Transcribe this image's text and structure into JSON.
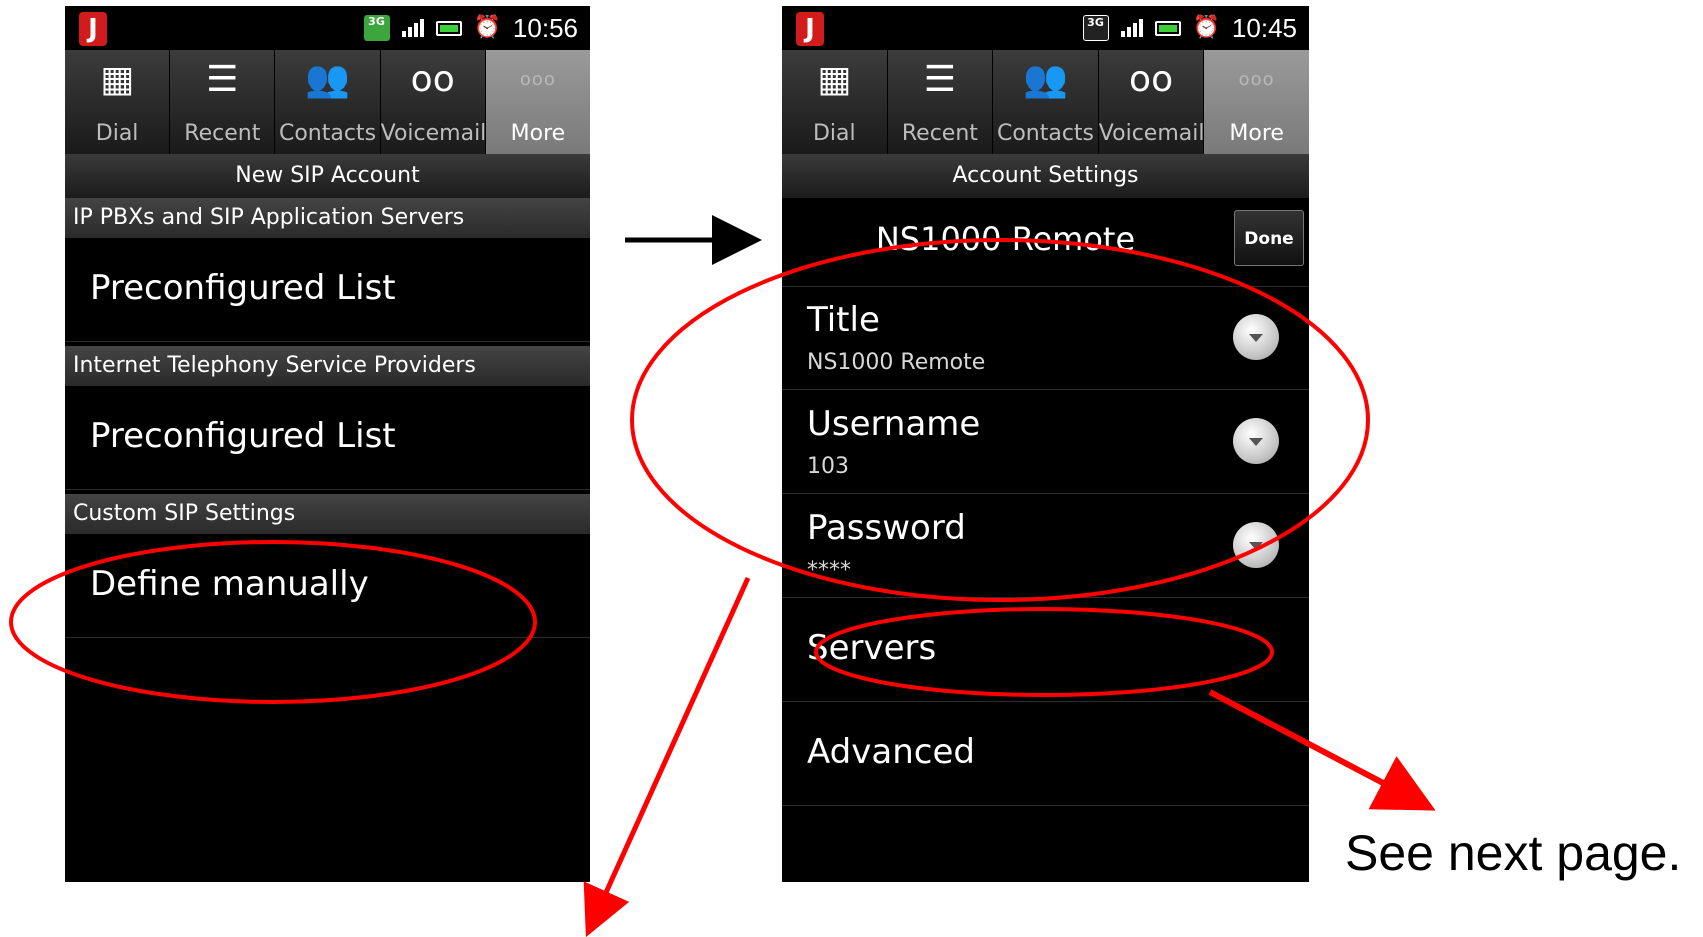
{
  "left_screen": {
    "status": {
      "network": "3G",
      "time": "10:56"
    },
    "tabs": [
      {
        "label": "Dial",
        "icon": "dialpad-icon"
      },
      {
        "label": "Recent",
        "icon": "list-icon"
      },
      {
        "label": "Contacts",
        "icon": "contacts-icon"
      },
      {
        "label": "Voicemail",
        "icon": "voicemail-icon"
      },
      {
        "label": "More",
        "icon": "more-icon",
        "active": true
      }
    ],
    "title": "New SIP Account",
    "sections": [
      {
        "header": "IP PBXs and SIP Application Servers",
        "item": "Preconfigured List"
      },
      {
        "header": "Internet Telephony Service Providers",
        "item": "Preconfigured List"
      },
      {
        "header": "Custom SIP Settings",
        "item": "Define manually"
      }
    ]
  },
  "right_screen": {
    "status": {
      "network": "3G",
      "time": "10:45"
    },
    "tabs": [
      {
        "label": "Dial",
        "icon": "dialpad-icon"
      },
      {
        "label": "Recent",
        "icon": "list-icon"
      },
      {
        "label": "Contacts",
        "icon": "contacts-icon"
      },
      {
        "label": "Voicemail",
        "icon": "voicemail-icon"
      },
      {
        "label": "More",
        "icon": "more-icon",
        "active": true
      }
    ],
    "title": "Account Settings",
    "account_name": "NS1000 Remote",
    "done_label": "Done",
    "settings": [
      {
        "label": "Title",
        "value": "NS1000 Remote"
      },
      {
        "label": "Username",
        "value": "103"
      },
      {
        "label": "Password",
        "value": "****"
      }
    ],
    "links": [
      {
        "label": "Servers"
      },
      {
        "label": "Advanced"
      }
    ]
  },
  "annotation": {
    "note": "See next page.",
    "highlight_color": "#ff0000"
  }
}
